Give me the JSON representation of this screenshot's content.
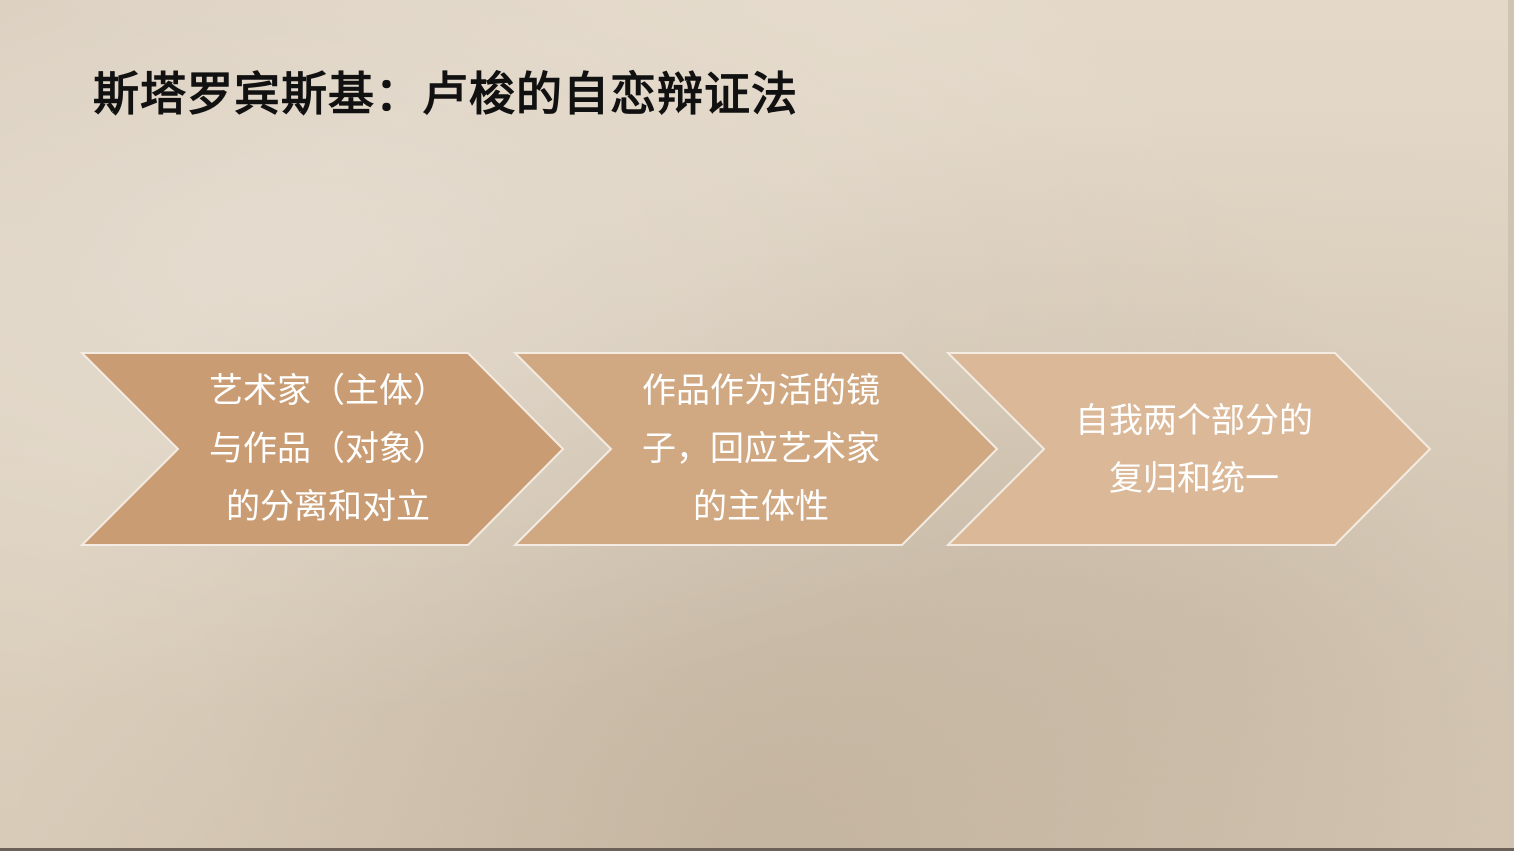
{
  "slide": {
    "title": "斯塔罗宾斯基：卢梭的自恋辩证法",
    "steps": [
      {
        "text": "艺术家（主体）\n与作品（对象）\n的分离和对立",
        "color": "#c99c74"
      },
      {
        "text": "作品作为活的镜\n子，回应艺术家\n的主体性",
        "color": "#d0a882"
      },
      {
        "text": "自我两个部分的\n复归和统一",
        "color": "#dab898"
      }
    ]
  }
}
